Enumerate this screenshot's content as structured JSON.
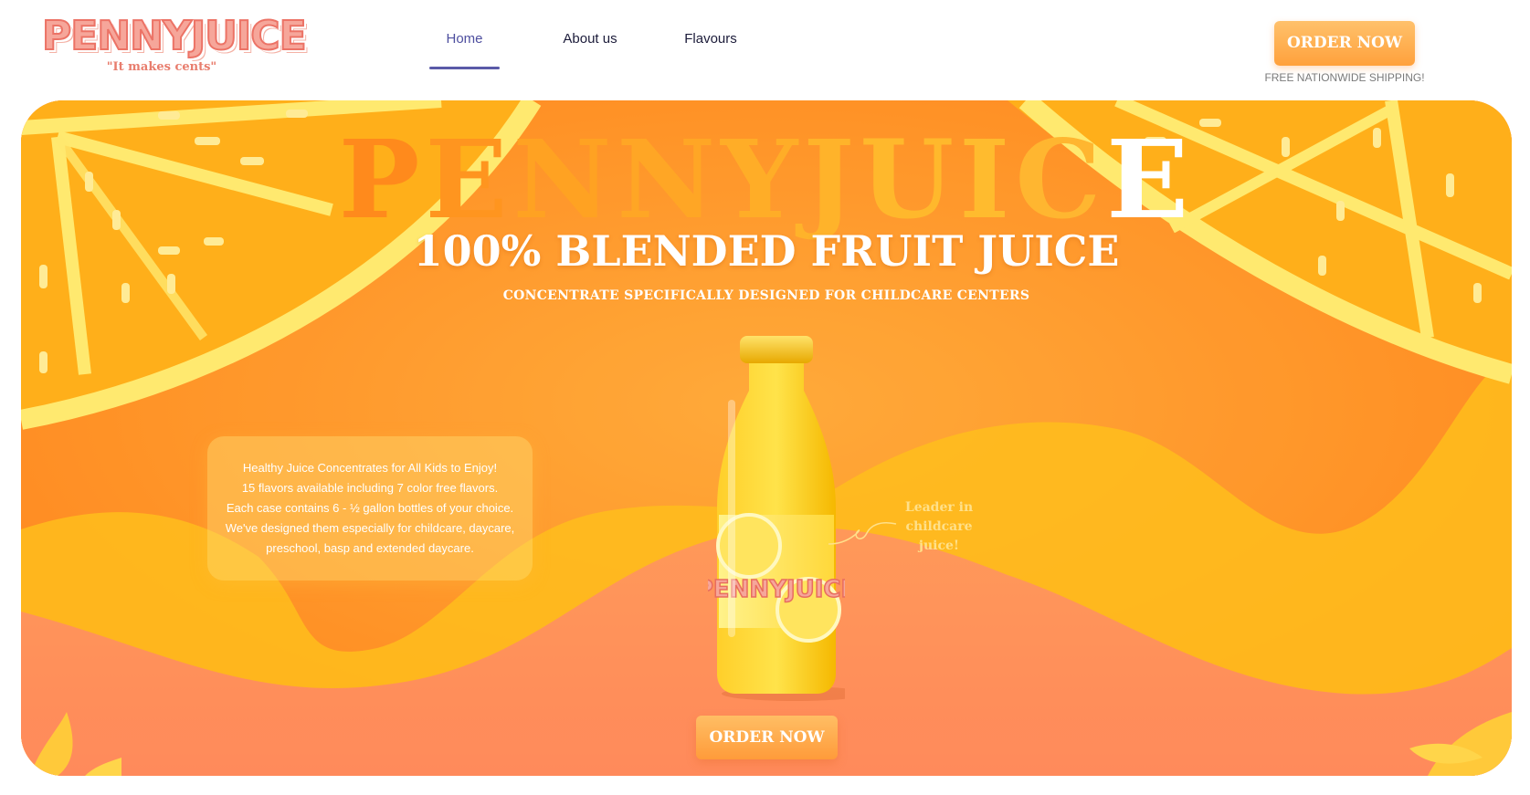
{
  "brand": {
    "logo_text": "PENNYJUICE",
    "tagline": "\"It makes cents\""
  },
  "nav": {
    "items": [
      {
        "label": "Home",
        "active": true
      },
      {
        "label": "About us",
        "active": false
      },
      {
        "label": "Flavours",
        "active": false
      }
    ]
  },
  "header_cta": {
    "order_label": "ORDER NOW",
    "shipping_note": "FREE NATIONWIDE SHIPPING!"
  },
  "hero": {
    "big_title_letters": [
      "P",
      "E",
      "N",
      "N",
      "Y",
      "J",
      "U",
      "I",
      "C",
      "E"
    ],
    "big_title_colors": [
      "#ff8a1c",
      "#ff951f",
      "#ffa222",
      "#ffa625",
      "#ffad27",
      "#ffb32a",
      "#ffb82c",
      "#ffbb2e",
      "#ffb630",
      "#ffffff"
    ],
    "headline": "100% BLENDED FRUIT JUICE",
    "subheadline": "CONCENTRATE SPECIFICALLY DESIGNED FOR CHILDCARE CENTERS",
    "info_lines": [
      "Healthy Juice Concentrates for All Kids to Enjoy!",
      "15 flavors available including 7 color free flavors.",
      "Each case contains 6 - ½ gallon bottles of your choice.",
      "We've designed them especially for childcare, daycare,",
      "preschool, basp and extended daycare."
    ],
    "leader_lines": [
      "Leader in",
      "childcare",
      "juice!"
    ],
    "bottle_label": "PENNYJUICE",
    "order_label": "ORDER NOW"
  },
  "colors": {
    "brand_pink": "#f6a69a",
    "accent_orange": "#ffa13c",
    "nav_active": "#5a5aa8",
    "hero_orange": "#ff9a2a"
  }
}
